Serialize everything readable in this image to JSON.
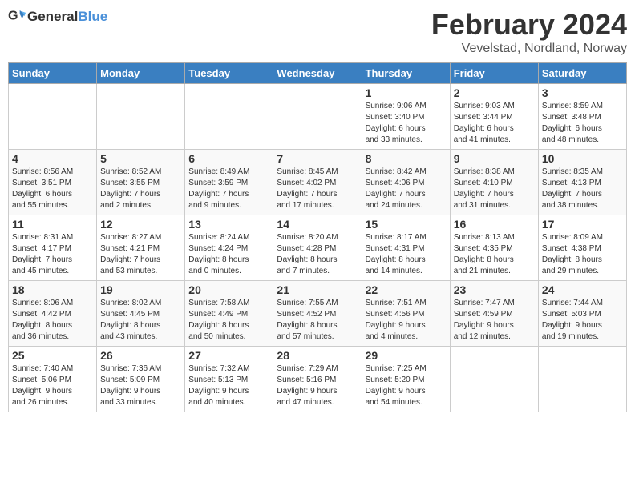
{
  "header": {
    "logo_general": "General",
    "logo_blue": "Blue",
    "month_title": "February 2024",
    "location": "Vevelstad, Nordland, Norway"
  },
  "days_of_week": [
    "Sunday",
    "Monday",
    "Tuesday",
    "Wednesday",
    "Thursday",
    "Friday",
    "Saturday"
  ],
  "weeks": [
    [
      {
        "day": "",
        "info": ""
      },
      {
        "day": "",
        "info": ""
      },
      {
        "day": "",
        "info": ""
      },
      {
        "day": "",
        "info": ""
      },
      {
        "day": "1",
        "info": "Sunrise: 9:06 AM\nSunset: 3:40 PM\nDaylight: 6 hours\nand 33 minutes."
      },
      {
        "day": "2",
        "info": "Sunrise: 9:03 AM\nSunset: 3:44 PM\nDaylight: 6 hours\nand 41 minutes."
      },
      {
        "day": "3",
        "info": "Sunrise: 8:59 AM\nSunset: 3:48 PM\nDaylight: 6 hours\nand 48 minutes."
      }
    ],
    [
      {
        "day": "4",
        "info": "Sunrise: 8:56 AM\nSunset: 3:51 PM\nDaylight: 6 hours\nand 55 minutes."
      },
      {
        "day": "5",
        "info": "Sunrise: 8:52 AM\nSunset: 3:55 PM\nDaylight: 7 hours\nand 2 minutes."
      },
      {
        "day": "6",
        "info": "Sunrise: 8:49 AM\nSunset: 3:59 PM\nDaylight: 7 hours\nand 9 minutes."
      },
      {
        "day": "7",
        "info": "Sunrise: 8:45 AM\nSunset: 4:02 PM\nDaylight: 7 hours\nand 17 minutes."
      },
      {
        "day": "8",
        "info": "Sunrise: 8:42 AM\nSunset: 4:06 PM\nDaylight: 7 hours\nand 24 minutes."
      },
      {
        "day": "9",
        "info": "Sunrise: 8:38 AM\nSunset: 4:10 PM\nDaylight: 7 hours\nand 31 minutes."
      },
      {
        "day": "10",
        "info": "Sunrise: 8:35 AM\nSunset: 4:13 PM\nDaylight: 7 hours\nand 38 minutes."
      }
    ],
    [
      {
        "day": "11",
        "info": "Sunrise: 8:31 AM\nSunset: 4:17 PM\nDaylight: 7 hours\nand 45 minutes."
      },
      {
        "day": "12",
        "info": "Sunrise: 8:27 AM\nSunset: 4:21 PM\nDaylight: 7 hours\nand 53 minutes."
      },
      {
        "day": "13",
        "info": "Sunrise: 8:24 AM\nSunset: 4:24 PM\nDaylight: 8 hours\nand 0 minutes."
      },
      {
        "day": "14",
        "info": "Sunrise: 8:20 AM\nSunset: 4:28 PM\nDaylight: 8 hours\nand 7 minutes."
      },
      {
        "day": "15",
        "info": "Sunrise: 8:17 AM\nSunset: 4:31 PM\nDaylight: 8 hours\nand 14 minutes."
      },
      {
        "day": "16",
        "info": "Sunrise: 8:13 AM\nSunset: 4:35 PM\nDaylight: 8 hours\nand 21 minutes."
      },
      {
        "day": "17",
        "info": "Sunrise: 8:09 AM\nSunset: 4:38 PM\nDaylight: 8 hours\nand 29 minutes."
      }
    ],
    [
      {
        "day": "18",
        "info": "Sunrise: 8:06 AM\nSunset: 4:42 PM\nDaylight: 8 hours\nand 36 minutes."
      },
      {
        "day": "19",
        "info": "Sunrise: 8:02 AM\nSunset: 4:45 PM\nDaylight: 8 hours\nand 43 minutes."
      },
      {
        "day": "20",
        "info": "Sunrise: 7:58 AM\nSunset: 4:49 PM\nDaylight: 8 hours\nand 50 minutes."
      },
      {
        "day": "21",
        "info": "Sunrise: 7:55 AM\nSunset: 4:52 PM\nDaylight: 8 hours\nand 57 minutes."
      },
      {
        "day": "22",
        "info": "Sunrise: 7:51 AM\nSunset: 4:56 PM\nDaylight: 9 hours\nand 4 minutes."
      },
      {
        "day": "23",
        "info": "Sunrise: 7:47 AM\nSunset: 4:59 PM\nDaylight: 9 hours\nand 12 minutes."
      },
      {
        "day": "24",
        "info": "Sunrise: 7:44 AM\nSunset: 5:03 PM\nDaylight: 9 hours\nand 19 minutes."
      }
    ],
    [
      {
        "day": "25",
        "info": "Sunrise: 7:40 AM\nSunset: 5:06 PM\nDaylight: 9 hours\nand 26 minutes."
      },
      {
        "day": "26",
        "info": "Sunrise: 7:36 AM\nSunset: 5:09 PM\nDaylight: 9 hours\nand 33 minutes."
      },
      {
        "day": "27",
        "info": "Sunrise: 7:32 AM\nSunset: 5:13 PM\nDaylight: 9 hours\nand 40 minutes."
      },
      {
        "day": "28",
        "info": "Sunrise: 7:29 AM\nSunset: 5:16 PM\nDaylight: 9 hours\nand 47 minutes."
      },
      {
        "day": "29",
        "info": "Sunrise: 7:25 AM\nSunset: 5:20 PM\nDaylight: 9 hours\nand 54 minutes."
      },
      {
        "day": "",
        "info": ""
      },
      {
        "day": "",
        "info": ""
      }
    ]
  ]
}
